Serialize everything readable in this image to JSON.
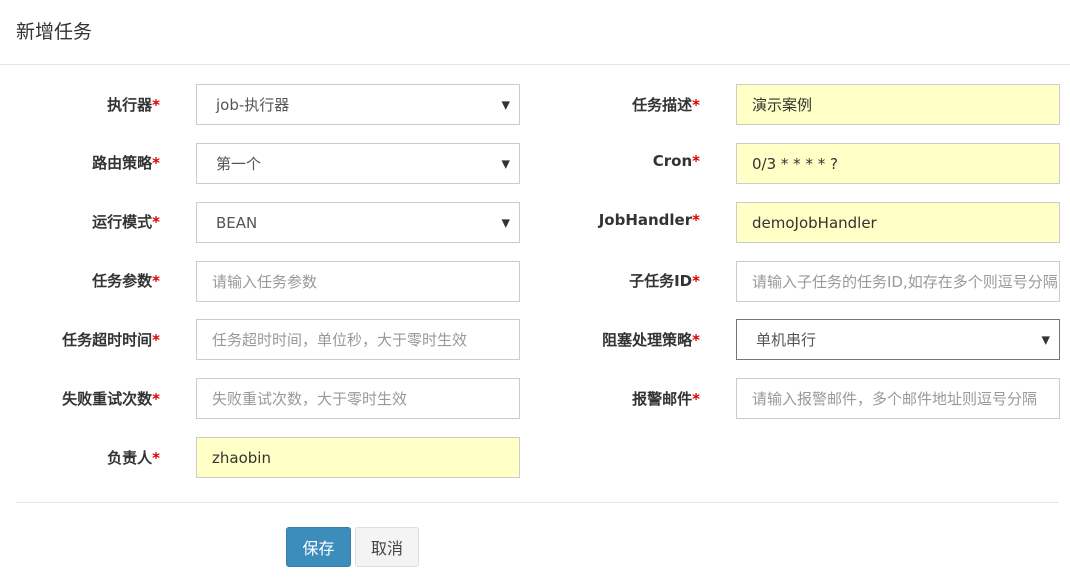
{
  "dialog": {
    "title": "新增任务"
  },
  "required_mark": "*",
  "left": [
    {
      "label": "执行器",
      "value": "job-执行器",
      "kind": "select"
    },
    {
      "label": "路由策略",
      "value": "第一个",
      "kind": "select"
    },
    {
      "label": "运行模式",
      "value": "BEAN",
      "kind": "select"
    },
    {
      "label": "任务参数",
      "placeholder": "请输入任务参数",
      "kind": "input"
    },
    {
      "label": "任务超时时间",
      "placeholder": "任务超时时间，单位秒，大于零时生效",
      "kind": "input"
    },
    {
      "label": "失败重试次数",
      "placeholder": "失败重试次数，大于零时生效",
      "kind": "input"
    },
    {
      "label": "负责人",
      "value": "zhaobin",
      "kind": "input"
    }
  ],
  "right": [
    {
      "label": "任务描述",
      "value": "演示案例",
      "kind": "input"
    },
    {
      "label": "Cron",
      "value": "0/3 * * * * ?",
      "kind": "input"
    },
    {
      "label": "JobHandler",
      "value": "demoJobHandler",
      "kind": "input"
    },
    {
      "label": "子任务ID",
      "placeholder": "请输入子任务的任务ID,如存在多个则逗号分隔",
      "kind": "input"
    },
    {
      "label": "阻塞处理策略",
      "value": "单机串行",
      "kind": "select"
    },
    {
      "label": "报警邮件",
      "placeholder": "请输入报警邮件，多个邮件地址则逗号分隔",
      "kind": "input"
    }
  ],
  "icons": {
    "caret": "▼"
  },
  "buttons": {
    "save": "保存",
    "cancel": "取消"
  },
  "colors": {
    "primary": "#3c8dbc",
    "filled_bg": "#ffffc6",
    "required": "#dd0000"
  }
}
